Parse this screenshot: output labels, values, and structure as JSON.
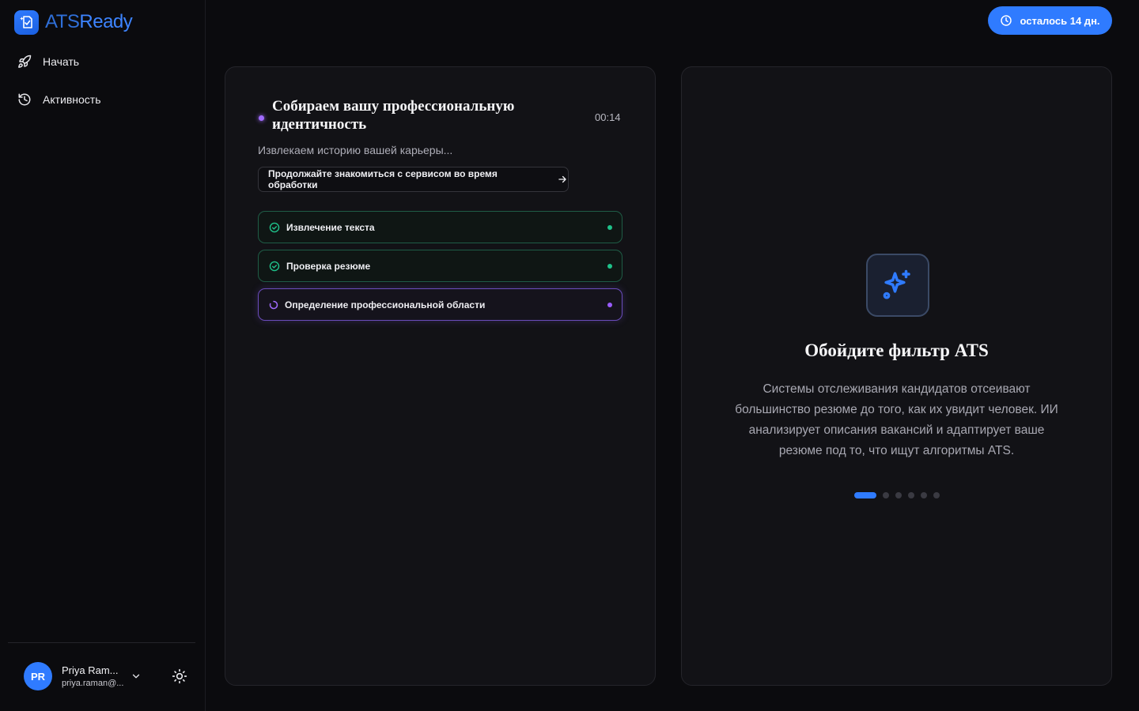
{
  "brand": {
    "name_part1": "ATS",
    "name_part2": "Ready"
  },
  "sidebar": {
    "items": [
      {
        "label": "Начать",
        "icon": "rocket-icon"
      },
      {
        "label": "Активность",
        "icon": "history-icon"
      }
    ],
    "user": {
      "initials": "PR",
      "name": "Priya Ram...",
      "email": "priya.raman@..."
    }
  },
  "header": {
    "trial_label": "осталось 14 дн."
  },
  "processing": {
    "title": "Собираем вашу профессиональную идентичность",
    "timer": "00:14",
    "subtitle": "Извлекаем историю вашей карьеры...",
    "continue_label": "Продолжайте знакомиться с сервисом во время обработки",
    "steps": [
      {
        "label": "Извлечение текста",
        "status": "done"
      },
      {
        "label": "Проверка резюме",
        "status": "done"
      },
      {
        "label": "Определение профессиональной области",
        "status": "active"
      }
    ]
  },
  "feature": {
    "icon": "sparkles-icon",
    "title": "Обойдите фильтр ATS",
    "description": "Системы отслеживания кандидатов отсеивают большинство резюме до того, как их увидит человек. ИИ анализирует описания вакансий и адаптирует ваше резюме под то, что ищут алгоритмы ATS.",
    "slides_total": 6,
    "slide_active": 1
  },
  "colors": {
    "accent": "#2f7bff",
    "success": "#1fc28a",
    "active": "#9a5cff",
    "background": "#0b0b0e",
    "card": "#121216"
  }
}
